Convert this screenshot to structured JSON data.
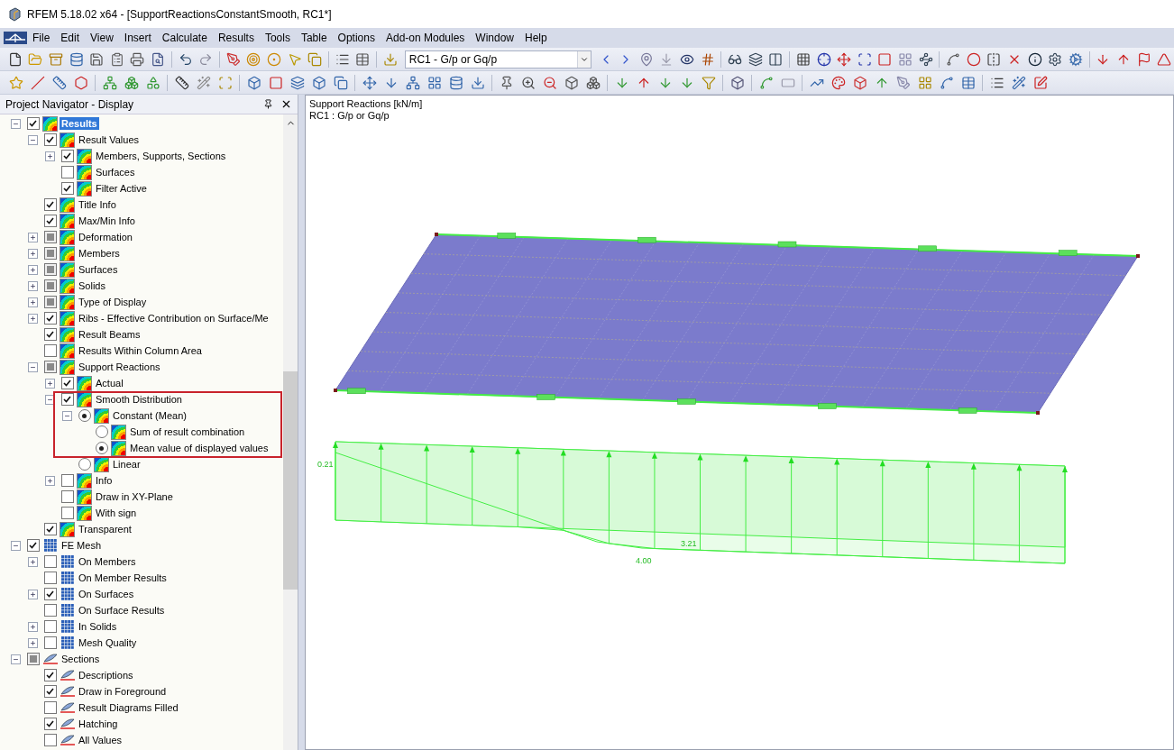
{
  "window": {
    "title": "RFEM 5.18.02 x64 - [SupportReactionsConstantSmooth, RC1*]"
  },
  "menu": [
    "File",
    "Edit",
    "View",
    "Insert",
    "Calculate",
    "Results",
    "Tools",
    "Table",
    "Options",
    "Add-on Modules",
    "Window",
    "Help"
  ],
  "load_case": {
    "value": "RC1 - G/p or Gq/p"
  },
  "navigator": {
    "title": "Project Navigator - Display",
    "tree": [
      {
        "label": "Results",
        "kind": "checkbox",
        "checked": true,
        "expanded": true,
        "focused": true,
        "children": [
          {
            "label": "Result Values",
            "kind": "checkbox",
            "checked": true,
            "expanded": true,
            "children": [
              {
                "label": "Members, Supports, Sections",
                "kind": "checkbox",
                "checked": true,
                "expanded": false
              },
              {
                "label": "Surfaces",
                "kind": "checkbox",
                "checked": false
              },
              {
                "label": "Filter Active",
                "kind": "checkbox",
                "checked": true
              }
            ]
          },
          {
            "label": "Title Info",
            "kind": "checkbox",
            "checked": true
          },
          {
            "label": "Max/Min Info",
            "kind": "checkbox",
            "checked": true
          },
          {
            "label": "Deformation",
            "kind": "checkbox",
            "checked": false,
            "mixed": true,
            "expanded": false
          },
          {
            "label": "Members",
            "kind": "checkbox",
            "checked": false,
            "mixed": true,
            "expanded": false
          },
          {
            "label": "Surfaces",
            "kind": "checkbox",
            "checked": false,
            "mixed": true,
            "expanded": false
          },
          {
            "label": "Solids",
            "kind": "checkbox",
            "checked": false,
            "mixed": true,
            "expanded": false
          },
          {
            "label": "Type of Display",
            "kind": "checkbox",
            "checked": false,
            "mixed": true,
            "expanded": false
          },
          {
            "label": "Ribs - Effective Contribution on Surface/Me",
            "kind": "checkbox",
            "checked": true,
            "expanded": false
          },
          {
            "label": "Result Beams",
            "kind": "checkbox",
            "checked": true
          },
          {
            "label": "Results Within Column Area",
            "kind": "checkbox",
            "checked": false
          },
          {
            "label": "Support Reactions",
            "kind": "checkbox",
            "checked": false,
            "mixed": true,
            "expanded": true,
            "children": [
              {
                "label": "Actual",
                "kind": "checkbox",
                "checked": true,
                "expanded": false
              },
              {
                "label": "Smooth Distribution",
                "kind": "checkbox",
                "checked": true,
                "expanded": true,
                "highlighted": true,
                "children": [
                  {
                    "label": "Constant (Mean)",
                    "kind": "radio",
                    "selected": true,
                    "expanded": true,
                    "highlighted": true,
                    "children": [
                      {
                        "label": "Sum of result combination",
                        "kind": "radio",
                        "selected": false,
                        "highlighted": true
                      },
                      {
                        "label": "Mean value of displayed values",
                        "kind": "radio",
                        "selected": true,
                        "highlighted": true
                      }
                    ]
                  },
                  {
                    "label": "Linear",
                    "kind": "radio",
                    "selected": false
                  }
                ]
              },
              {
                "label": "Info",
                "kind": "checkbox",
                "checked": false,
                "expanded": false
              },
              {
                "label": "Draw in XY-Plane",
                "kind": "checkbox",
                "checked": false
              },
              {
                "label": "With sign",
                "kind": "checkbox",
                "checked": false
              }
            ]
          },
          {
            "label": "Transparent",
            "kind": "checkbox",
            "checked": true
          }
        ]
      },
      {
        "label": "FE Mesh",
        "kind": "checkbox",
        "checked": true,
        "expanded": true,
        "children": [
          {
            "label": "On Members",
            "kind": "checkbox",
            "checked": false,
            "expanded": false
          },
          {
            "label": "On Member Results",
            "kind": "checkbox",
            "checked": false
          },
          {
            "label": "On Surfaces",
            "kind": "checkbox",
            "checked": true,
            "expanded": false
          },
          {
            "label": "On Surface Results",
            "kind": "checkbox",
            "checked": false
          },
          {
            "label": "In Solids",
            "kind": "checkbox",
            "checked": false,
            "expanded": false
          },
          {
            "label": "Mesh Quality",
            "kind": "checkbox",
            "checked": false,
            "expanded": false
          }
        ]
      },
      {
        "label": "Sections",
        "kind": "checkbox",
        "checked": false,
        "mixed": true,
        "expanded": true,
        "children": [
          {
            "label": "Descriptions",
            "kind": "checkbox",
            "checked": true
          },
          {
            "label": "Draw in Foreground",
            "kind": "checkbox",
            "checked": true
          },
          {
            "label": "Result Diagrams Filled",
            "kind": "checkbox",
            "checked": false
          },
          {
            "label": "Hatching",
            "kind": "checkbox",
            "checked": true
          },
          {
            "label": "All Values",
            "kind": "checkbox",
            "checked": false
          }
        ]
      }
    ]
  },
  "viewport": {
    "info_lines": [
      "Support Reactions [kN/m]",
      "RC1 : G/p or Gq/p"
    ],
    "diagram_labels": [
      "0.21",
      "3.21",
      "4.00"
    ]
  }
}
